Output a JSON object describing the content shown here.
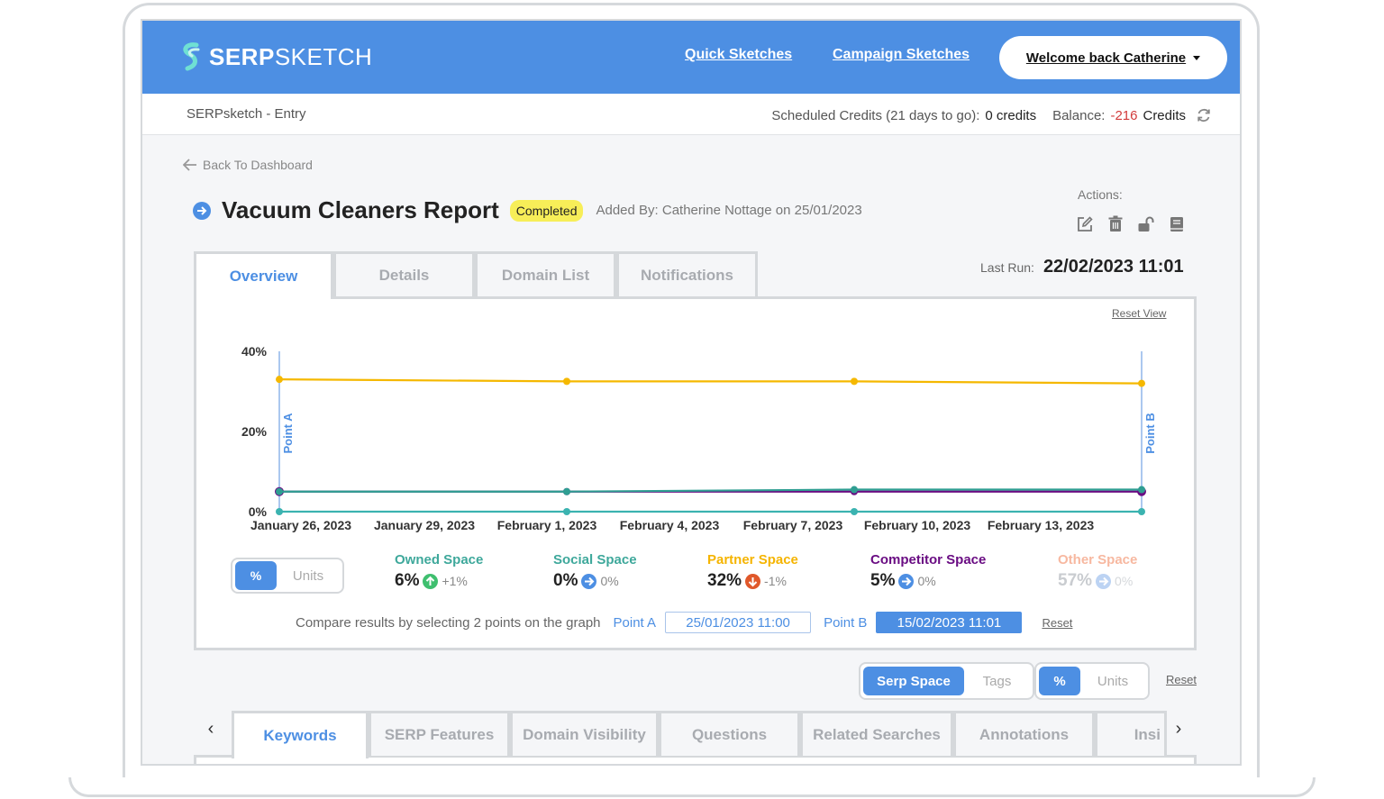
{
  "header": {
    "logo_bold": "SERP",
    "logo_light": "SKETCH",
    "nav": [
      "Quick Sketches",
      "Campaign Sketches"
    ],
    "welcome": "Welcome back Catherine"
  },
  "subbar": {
    "entry": "SERPsketch - Entry",
    "scheduled_label": "Scheduled Credits (21 days to go):",
    "scheduled_value": "0 credits",
    "balance_label": "Balance:",
    "balance_value": "-216",
    "balance_unit": "Credits"
  },
  "back_link": "Back To Dashboard",
  "report": {
    "title": "Vacuum Cleaners Report",
    "status": "Completed",
    "added_by": "Added By: Catherine Nottage on 25/01/2023"
  },
  "actions": {
    "label": "Actions:",
    "icons": [
      "edit-icon",
      "trash-icon",
      "unlock-icon",
      "book-icon"
    ]
  },
  "last_run": {
    "label": "Last Run:",
    "value": "22/02/2023 11:01"
  },
  "tabs": [
    "Overview",
    "Details",
    "Domain List",
    "Notifications"
  ],
  "reset_view": "Reset View",
  "chart_data": {
    "type": "line",
    "x": [
      "January 26, 2023",
      "February 1, 2023",
      "February 7, 2023",
      "February 13, 2023"
    ],
    "x_tick_labels": [
      "January 26, 2023",
      "January 29, 2023",
      "February 1, 2023",
      "February 4, 2023",
      "February 7, 2023",
      "February 10, 2023",
      "February 13, 2023"
    ],
    "y_tick_labels": [
      "0%",
      "20%",
      "40%"
    ],
    "ylim": [
      0,
      40
    ],
    "series": [
      {
        "name": "Partner Space",
        "color": "#f5b800",
        "values": [
          33,
          32.5,
          32.5,
          32
        ]
      },
      {
        "name": "Owned Space",
        "color": "#2f9e92",
        "values": [
          5,
          5,
          5.5,
          5.5
        ]
      },
      {
        "name": "Competitor Space",
        "color": "#6a0d83",
        "values": [
          5,
          5,
          5,
          5
        ]
      },
      {
        "name": "Social Space",
        "color": "#3bb3b0",
        "values": [
          0,
          0,
          0,
          0
        ]
      }
    ],
    "markers": [
      {
        "label": "Point A",
        "x": "January 26, 2023"
      },
      {
        "label": "Point B",
        "x": "February 13, 2023"
      }
    ]
  },
  "unit_toggle": {
    "on": "%",
    "off": "Units"
  },
  "metrics": [
    {
      "name": "Owned Space",
      "color": "#3ea89b",
      "pct": "6%",
      "change": "+1%",
      "dir": "up",
      "icon_color": "#3fbf6f"
    },
    {
      "name": "Social Space",
      "color": "#3ea89b",
      "pct": "0%",
      "change": "0%",
      "dir": "right",
      "icon_color": "#4d8fe3"
    },
    {
      "name": "Partner Space",
      "color": "#f5b400",
      "pct": "32%",
      "change": "-1%",
      "dir": "down",
      "icon_color": "#e0582a"
    },
    {
      "name": "Competitor Space",
      "color": "#6a0d83",
      "pct": "5%",
      "change": "0%",
      "dir": "right",
      "icon_color": "#4d8fe3"
    },
    {
      "name": "Other Space",
      "color": "#f7b8a0",
      "pct": "57%",
      "change": "0%",
      "dir": "right",
      "icon_color": "#bcd3f3"
    }
  ],
  "compare": {
    "text": "Compare results by selecting 2 points on the graph",
    "point_a_label": "Point A",
    "point_a_value": "25/01/2023 11:00",
    "point_b_label": "Point B",
    "point_b_value": "15/02/2023 11:01",
    "reset": "Reset"
  },
  "view_toggle": {
    "on": "Serp Space",
    "off": "Tags"
  },
  "unit_toggle2": {
    "on": "%",
    "off": "Units"
  },
  "view_reset": "Reset",
  "bottom_tabs": [
    "Keywords",
    "SERP Features",
    "Domain Visibility",
    "Questions",
    "Related Searches",
    "Annotations",
    "Insi"
  ]
}
